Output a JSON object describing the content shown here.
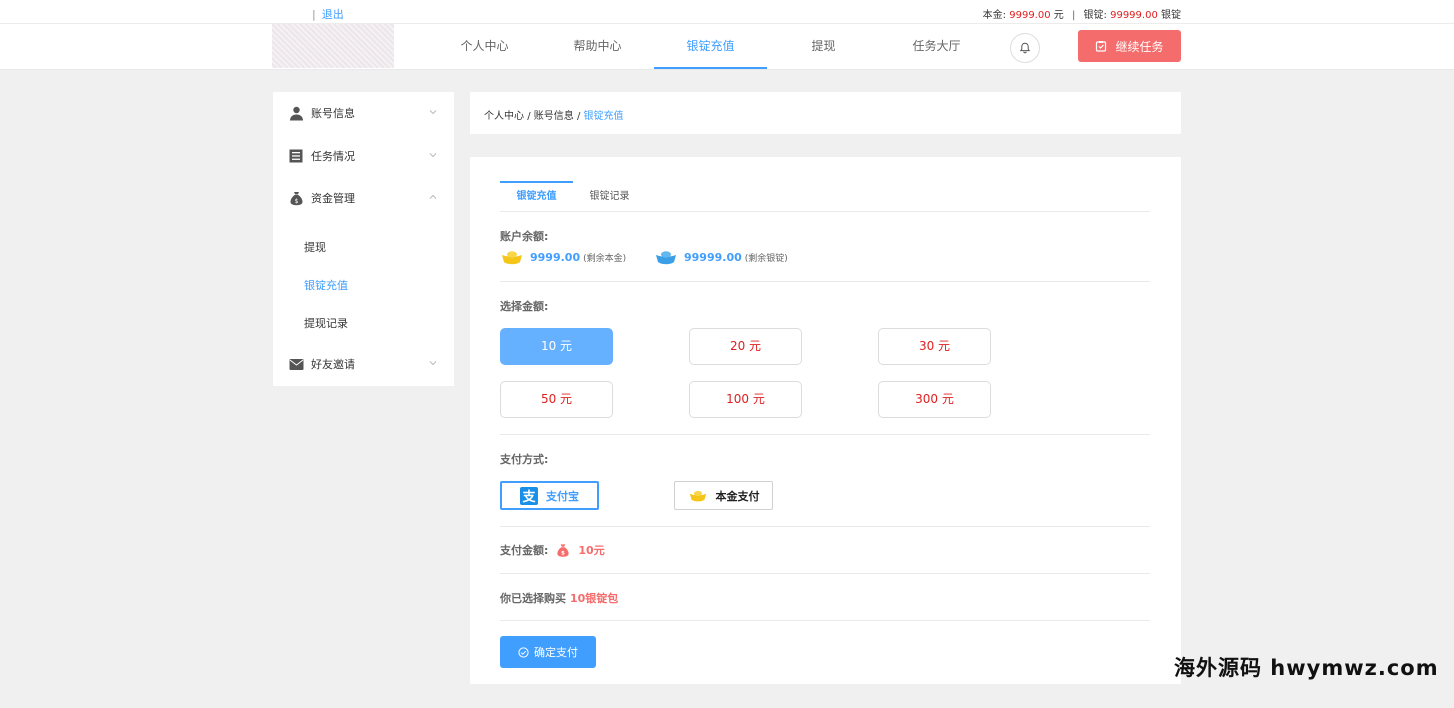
{
  "topbar": {
    "logout": "退出",
    "principal_label": "本金:",
    "principal_value": "9999.00",
    "principal_unit": "元",
    "silver_label": "银锭:",
    "silver_value": "99999.00",
    "silver_unit": "银锭"
  },
  "nav": {
    "items": [
      "个人中心",
      "帮助中心",
      "银锭充值",
      "提现",
      "任务大厅"
    ],
    "active": "银锭充值",
    "cta_label": "继续任务"
  },
  "sidebar": {
    "account": "账号信息",
    "tasks": "任务情况",
    "funds": "资金管理",
    "sub": [
      "提现",
      "银锭充值",
      "提现记录"
    ],
    "invite": "好友邀请"
  },
  "breadcrumb": {
    "p1": "个人中心",
    "p2": "账号信息",
    "current": "银锭充值",
    "sep": "/"
  },
  "main": {
    "tabs": [
      "银锭充值",
      "银锭记录"
    ],
    "balance_label": "账户余额:",
    "gold_amount": "9999.00",
    "gold_note": "(剩余本金)",
    "silver_amount": "99999.00",
    "silver_note": "(剩余银锭)",
    "amount_label": "选择金额:",
    "amounts": [
      "10 元",
      "20 元",
      "30 元",
      "50 元",
      "100 元",
      "300 元"
    ],
    "payment_label": "支付方式:",
    "pay_alipay": "支付宝",
    "pay_wallet": "本金支付",
    "paid_label": "支付金额:",
    "paid_value": "10元",
    "chosen_label": "你已选择购买",
    "chosen_value": "10银锭包",
    "confirm": "确定支付"
  },
  "watermark": "海外源码 hwymwz.com",
  "colors": {
    "accent": "#409eff",
    "danger": "#f56c6c",
    "price": "#e02020"
  }
}
